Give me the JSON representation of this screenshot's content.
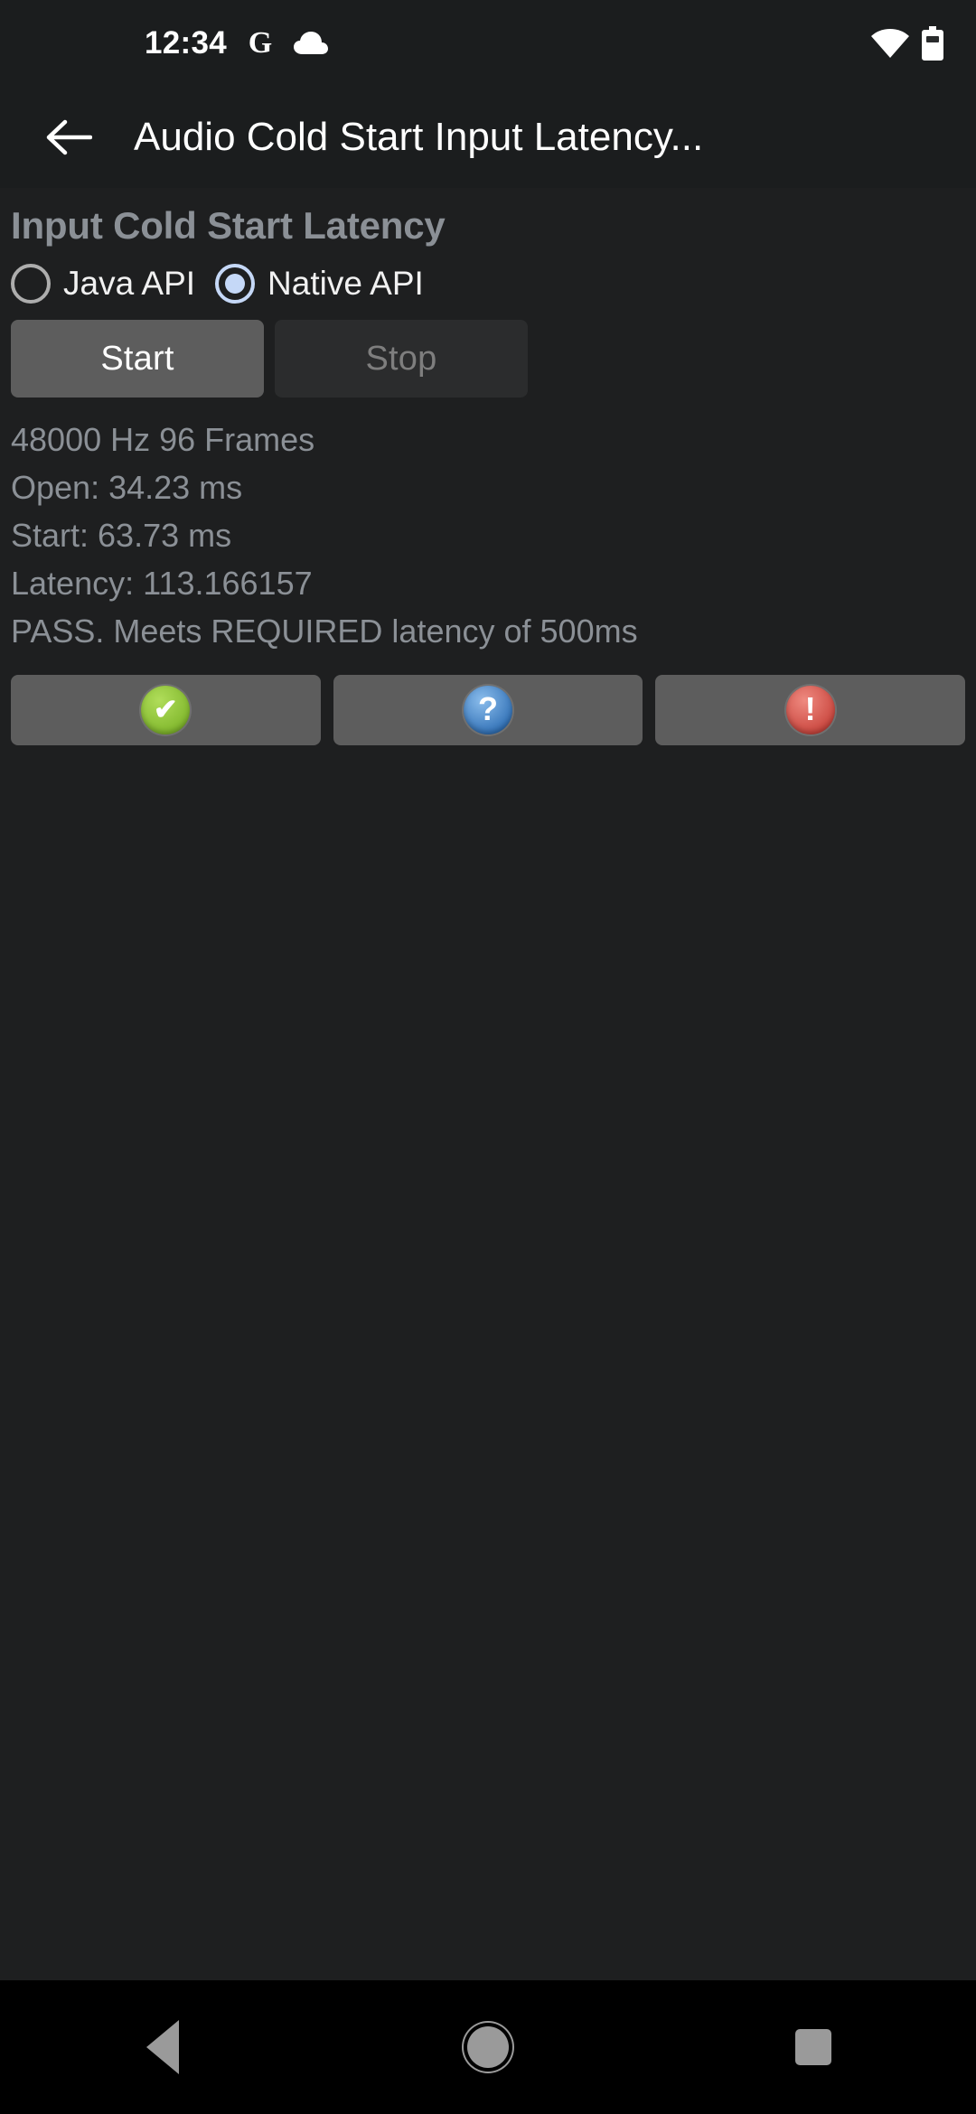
{
  "statusbar": {
    "time": "12:34",
    "icons": [
      "google-g-icon",
      "cloud-icon"
    ],
    "right_icons": [
      "wifi-icon",
      "battery-icon"
    ]
  },
  "actionbar": {
    "back_icon": "back-arrow-icon",
    "title": "Audio Cold Start Input Latency..."
  },
  "main": {
    "section_title": "Input Cold Start Latency",
    "radios": [
      {
        "label": "Java API",
        "checked": false
      },
      {
        "label": "Native API",
        "checked": true
      }
    ],
    "buttons": {
      "start": "Start",
      "stop": "Stop",
      "start_enabled": true,
      "stop_enabled": false
    },
    "results": [
      "48000 Hz 96 Frames",
      "Open: 34.23 ms",
      "Start: 63.73 ms",
      "Latency: 113.166157",
      "PASS. Meets REQUIRED latency of 500ms"
    ],
    "status_buttons": [
      {
        "icon": "pass-check-icon",
        "glyph": "✔",
        "color": "#8cc63f"
      },
      {
        "icon": "info-question-icon",
        "glyph": "?",
        "color": "#4a90d9"
      },
      {
        "icon": "fail-exclamation-icon",
        "glyph": "!",
        "color": "#d9534f"
      }
    ]
  },
  "navbar": {
    "items": [
      "nav-back-icon",
      "nav-home-icon",
      "nav-recents-icon"
    ]
  }
}
